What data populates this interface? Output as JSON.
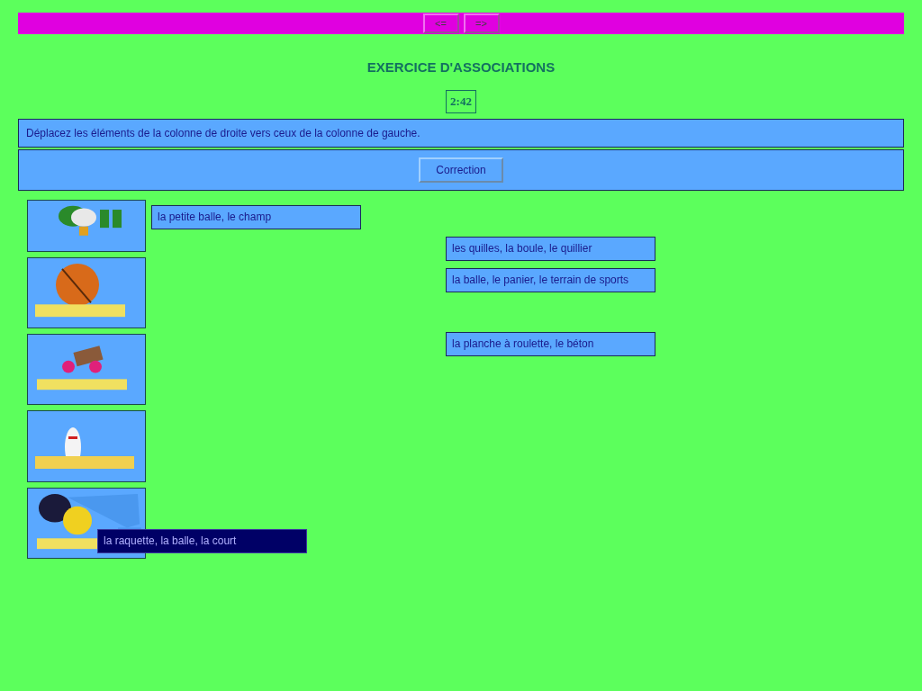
{
  "nav_buttons": [
    "<=",
    "=>"
  ],
  "title": "EXERCICE D'ASSOCIATIONS",
  "timer": "2:42",
  "instruction": "Déplacez les éléments de la colonne de droite vers ceux de la colonne de gauche.",
  "correction_button": "Correction",
  "items": [
    {
      "label": "la petite balle, le champ",
      "dragging": false
    },
    {
      "label": "les quilles, la boule, le quillier",
      "dragging": false
    },
    {
      "label": "la balle, le panier, le terrain de sports",
      "dragging": false
    },
    {
      "label": "la planche à roulette, le béton",
      "dragging": false
    },
    {
      "label": "la raquette, la balle, la court",
      "dragging": true
    }
  ]
}
